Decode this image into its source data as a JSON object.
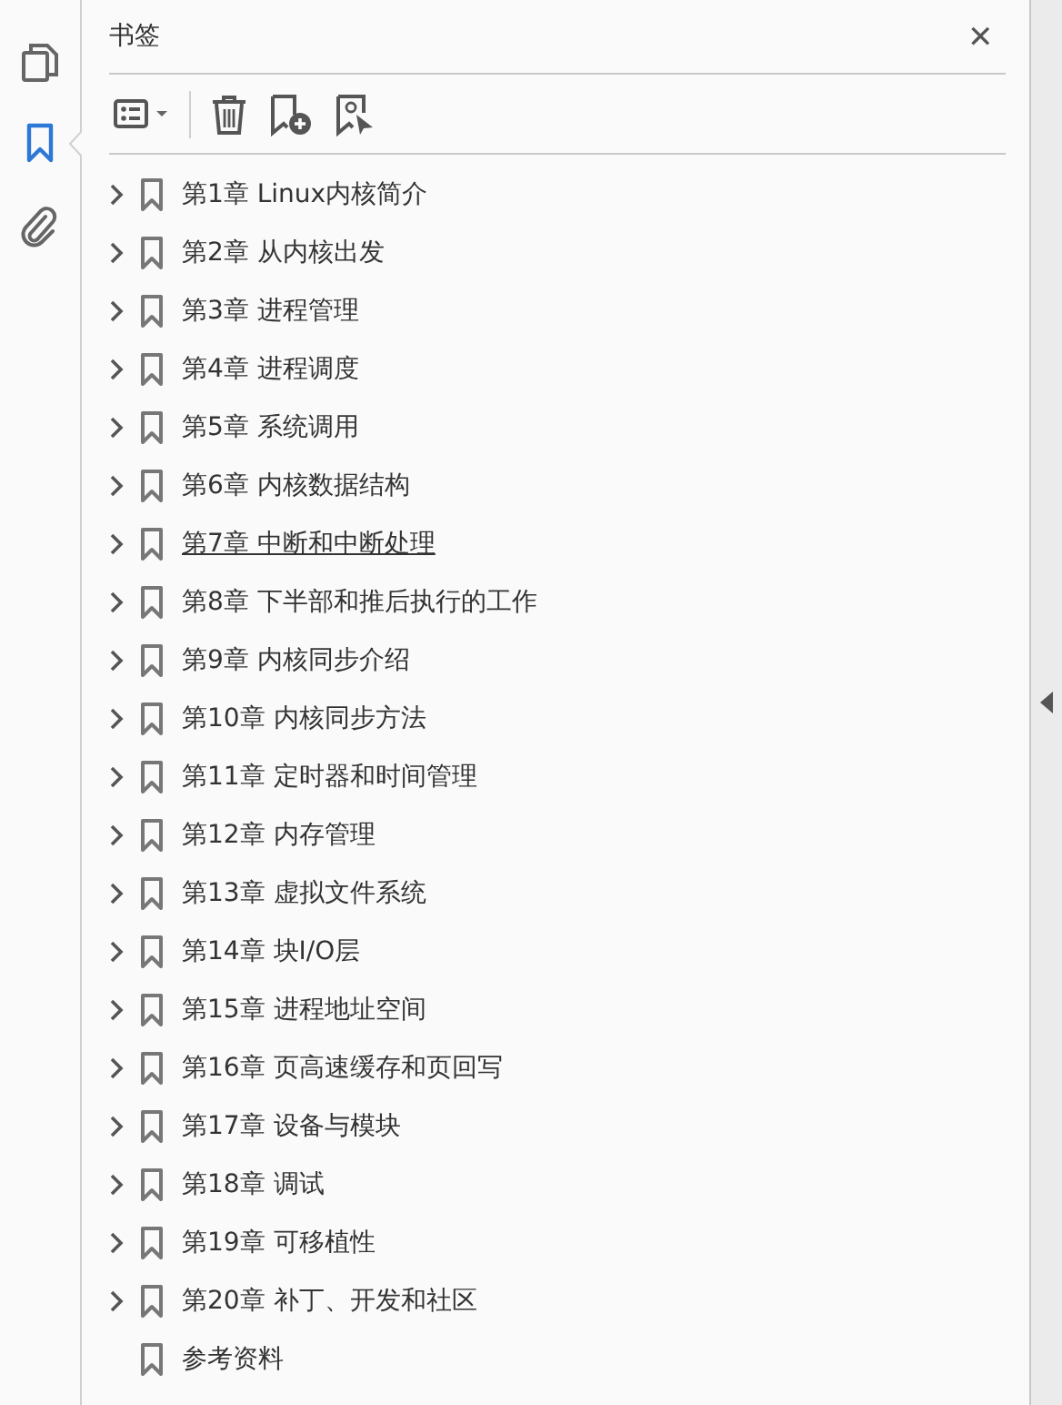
{
  "rail": [
    {
      "kind": "pages",
      "selected": false
    },
    {
      "kind": "bookmarks",
      "selected": true
    },
    {
      "kind": "attachments",
      "selected": false
    }
  ],
  "panel": {
    "title": "书签",
    "close": "✕"
  },
  "bookmarks": [
    {
      "label": "第1章 Linux内核简介",
      "expandable": true,
      "hovered": false
    },
    {
      "label": "第2章 从内核出发",
      "expandable": true,
      "hovered": false
    },
    {
      "label": "第3章 进程管理",
      "expandable": true,
      "hovered": false
    },
    {
      "label": "第4章 进程调度",
      "expandable": true,
      "hovered": false
    },
    {
      "label": "第5章 系统调用",
      "expandable": true,
      "hovered": false
    },
    {
      "label": "第6章 内核数据结构",
      "expandable": true,
      "hovered": false
    },
    {
      "label": "第7章 中断和中断处理",
      "expandable": true,
      "hovered": true
    },
    {
      "label": "第8章 下半部和推后执行的工作",
      "expandable": true,
      "hovered": false
    },
    {
      "label": "第9章 内核同步介绍",
      "expandable": true,
      "hovered": false
    },
    {
      "label": "第10章 内核同步方法",
      "expandable": true,
      "hovered": false
    },
    {
      "label": "第11章 定时器和时间管理",
      "expandable": true,
      "hovered": false
    },
    {
      "label": "第12章 内存管理",
      "expandable": true,
      "hovered": false
    },
    {
      "label": "第13章 虚拟文件系统",
      "expandable": true,
      "hovered": false
    },
    {
      "label": "第14章 块I/O层",
      "expandable": true,
      "hovered": false
    },
    {
      "label": "第15章 进程地址空间",
      "expandable": true,
      "hovered": false
    },
    {
      "label": "第16章 页高速缓存和页回写",
      "expandable": true,
      "hovered": false
    },
    {
      "label": "第17章 设备与模块",
      "expandable": true,
      "hovered": false
    },
    {
      "label": "第18章 调试",
      "expandable": true,
      "hovered": false
    },
    {
      "label": "第19章 可移植性",
      "expandable": true,
      "hovered": false
    },
    {
      "label": "第20章 补丁、开发和社区",
      "expandable": true,
      "hovered": false
    },
    {
      "label": "参考资料",
      "expandable": false,
      "hovered": false
    }
  ]
}
